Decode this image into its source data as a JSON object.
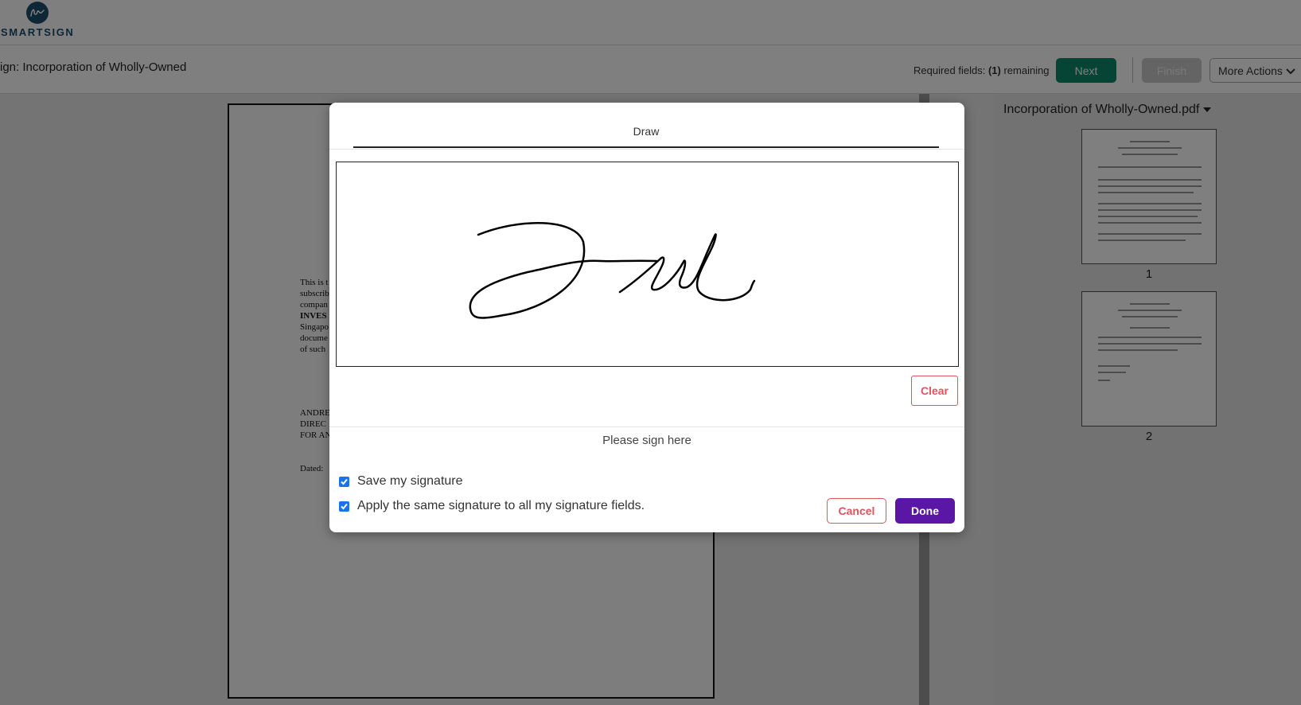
{
  "app": {
    "logo_text": "SMARTSIGN",
    "logo_icon": "smartsign-logo-icon"
  },
  "toolbar": {
    "title": "ign: Incorporation of Wholly-Owned",
    "required_prefix": "Required fields: ",
    "required_count": "(1)",
    "required_suffix": " remaining",
    "next_label": "Next",
    "finish_label": "Finish",
    "more_label": "More Actions",
    "more_icon": "chevron-down-icon"
  },
  "document": {
    "paragraph_lines": [
      "This is t",
      "subscrib",
      "compan",
      "INVES",
      "Singapo",
      "docume",
      "of such"
    ],
    "signer_lines": [
      "ANDRE",
      "DIREC",
      "FOR AN"
    ],
    "dated_label": "Dated:"
  },
  "thumbnails": {
    "file_name": "Incorporation of Wholly-Owned.pdf",
    "dropdown_icon": "caret-down-icon",
    "pages": [
      {
        "number": "1"
      },
      {
        "number": "2"
      }
    ]
  },
  "modal": {
    "tab_label": "Draw",
    "clear_label": "Clear",
    "hint": "Please sign here",
    "save_signature": {
      "label": "Save my signature",
      "checked": true
    },
    "apply_all": {
      "label": "Apply the same signature to all my signature fields.",
      "checked": true
    },
    "cancel_label": "Cancel",
    "done_label": "Done"
  },
  "colors": {
    "next": "#0c8a6b",
    "done": "#5a17a6",
    "danger": "#e0535f",
    "checkbox": "#1a73e8",
    "brand": "#1c4f6e"
  }
}
